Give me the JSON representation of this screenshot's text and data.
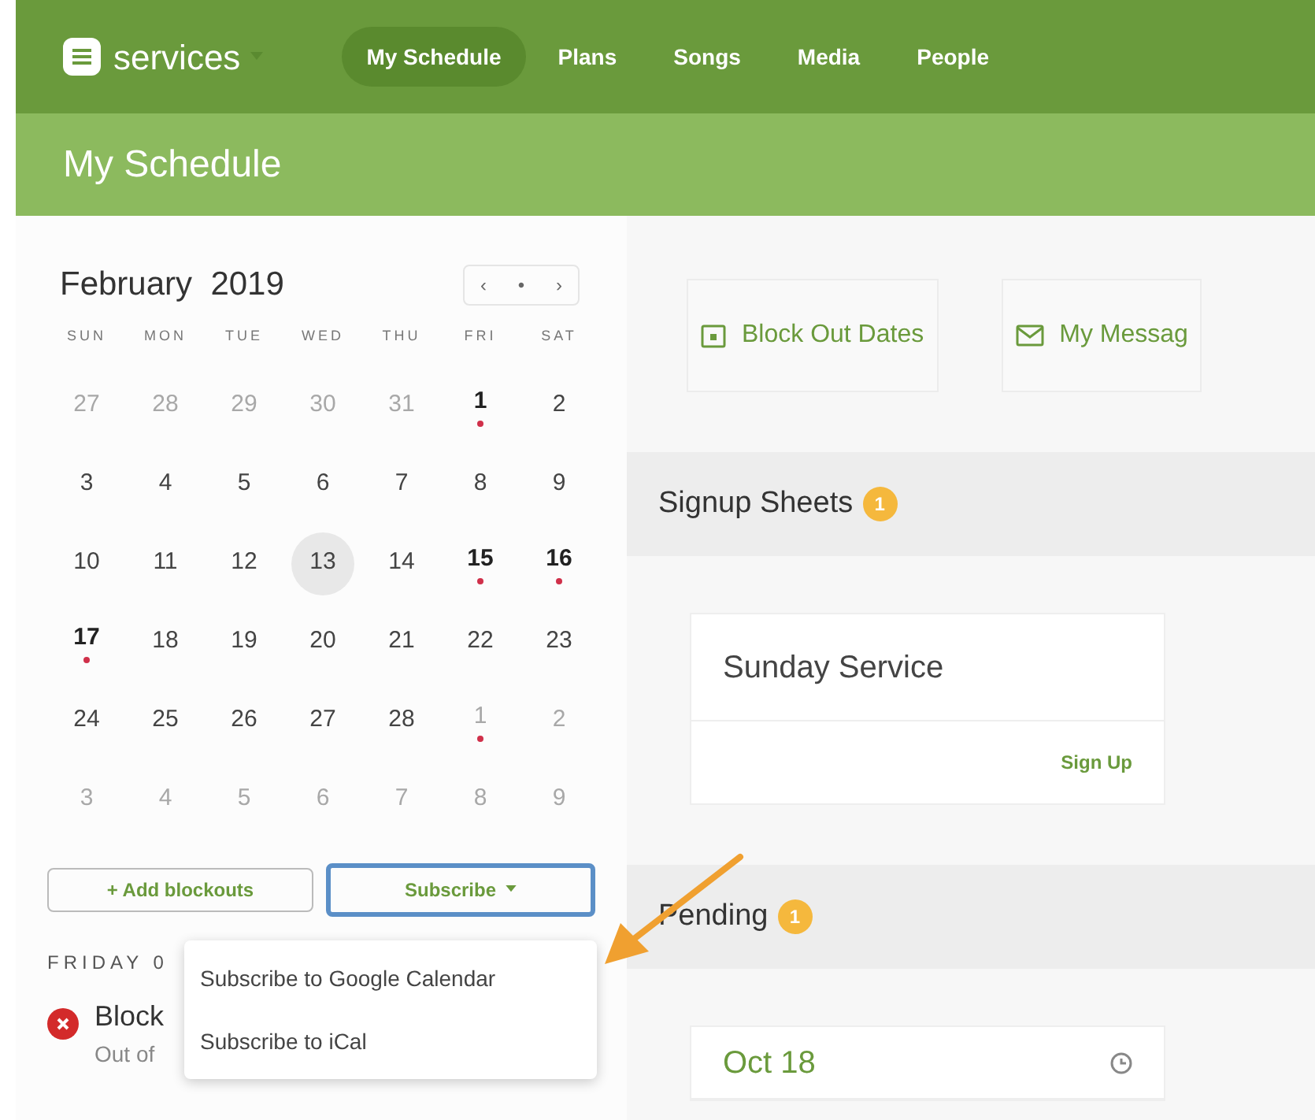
{
  "app": {
    "name": "services"
  },
  "nav": [
    {
      "label": "My Schedule",
      "selected": true
    },
    {
      "label": "Plans",
      "selected": false
    },
    {
      "label": "Songs",
      "selected": false
    },
    {
      "label": "Media",
      "selected": false
    },
    {
      "label": "People",
      "selected": false
    }
  ],
  "page_title": "My Schedule",
  "calendar": {
    "month": "February",
    "year": "2019",
    "controls": [
      "‹",
      "•",
      "›"
    ],
    "weekdays": [
      "SUN",
      "MON",
      "TUE",
      "WED",
      "THU",
      "FRI",
      "SAT"
    ],
    "weeks": [
      [
        {
          "label": "27",
          "muted": true,
          "event": false,
          "selected": false
        },
        {
          "label": "28",
          "muted": true,
          "event": false,
          "selected": false
        },
        {
          "label": "29",
          "muted": true,
          "event": false,
          "selected": false
        },
        {
          "label": "30",
          "muted": true,
          "event": false,
          "selected": false
        },
        {
          "label": "31",
          "muted": true,
          "event": false,
          "selected": false
        },
        {
          "label": "1",
          "muted": false,
          "event": true,
          "selected": false
        },
        {
          "label": "2",
          "muted": false,
          "event": false,
          "selected": false
        }
      ],
      [
        {
          "label": "3",
          "muted": false,
          "event": false,
          "selected": false
        },
        {
          "label": "4",
          "muted": false,
          "event": false,
          "selected": false
        },
        {
          "label": "5",
          "muted": false,
          "event": false,
          "selected": false
        },
        {
          "label": "6",
          "muted": false,
          "event": false,
          "selected": false
        },
        {
          "label": "7",
          "muted": false,
          "event": false,
          "selected": false
        },
        {
          "label": "8",
          "muted": false,
          "event": false,
          "selected": false
        },
        {
          "label": "9",
          "muted": false,
          "event": false,
          "selected": false
        }
      ],
      [
        {
          "label": "10",
          "muted": false,
          "event": false,
          "selected": false
        },
        {
          "label": "11",
          "muted": false,
          "event": false,
          "selected": false
        },
        {
          "label": "12",
          "muted": false,
          "event": false,
          "selected": false
        },
        {
          "label": "13",
          "muted": false,
          "event": false,
          "selected": true
        },
        {
          "label": "14",
          "muted": false,
          "event": false,
          "selected": false
        },
        {
          "label": "15",
          "muted": false,
          "event": true,
          "selected": false
        },
        {
          "label": "16",
          "muted": false,
          "event": true,
          "selected": false
        }
      ],
      [
        {
          "label": "17",
          "muted": false,
          "event": true,
          "selected": false
        },
        {
          "label": "18",
          "muted": false,
          "event": false,
          "selected": false
        },
        {
          "label": "19",
          "muted": false,
          "event": false,
          "selected": false
        },
        {
          "label": "20",
          "muted": false,
          "event": false,
          "selected": false
        },
        {
          "label": "21",
          "muted": false,
          "event": false,
          "selected": false
        },
        {
          "label": "22",
          "muted": false,
          "event": false,
          "selected": false
        },
        {
          "label": "23",
          "muted": false,
          "event": false,
          "selected": false
        }
      ],
      [
        {
          "label": "24",
          "muted": false,
          "event": false,
          "selected": false
        },
        {
          "label": "25",
          "muted": false,
          "event": false,
          "selected": false
        },
        {
          "label": "26",
          "muted": false,
          "event": false,
          "selected": false
        },
        {
          "label": "27",
          "muted": false,
          "event": false,
          "selected": false
        },
        {
          "label": "28",
          "muted": false,
          "event": false,
          "selected": false
        },
        {
          "label": "1",
          "muted": true,
          "event": true,
          "selected": false
        },
        {
          "label": "2",
          "muted": true,
          "event": false,
          "selected": false
        }
      ],
      [
        {
          "label": "3",
          "muted": true,
          "event": false,
          "selected": false
        },
        {
          "label": "4",
          "muted": true,
          "event": false,
          "selected": false
        },
        {
          "label": "5",
          "muted": true,
          "event": false,
          "selected": false
        },
        {
          "label": "6",
          "muted": true,
          "event": false,
          "selected": false
        },
        {
          "label": "7",
          "muted": true,
          "event": false,
          "selected": false
        },
        {
          "label": "8",
          "muted": true,
          "event": false,
          "selected": false
        },
        {
          "label": "9",
          "muted": true,
          "event": false,
          "selected": false
        }
      ]
    ]
  },
  "buttons": {
    "add": "+ Add blockouts",
    "subscribe": "Subscribe"
  },
  "subscribe_menu": {
    "expanded": true,
    "items": [
      "Subscribe to Google Calendar",
      "Subscribe to iCal"
    ]
  },
  "day_heading": "FRIDAY 0",
  "blockout": {
    "title": "Block",
    "subtitle": "Out of"
  },
  "actions": [
    "Block Out Dates",
    "My Messag"
  ],
  "sections": [
    {
      "title": "Signup Sheets",
      "count": "1",
      "cards": [
        {
          "title": "Sunday Service",
          "action": "Sign Up"
        }
      ]
    },
    {
      "title": "Pending",
      "count": "1",
      "cards": [
        {
          "title": "Oct 18"
        }
      ]
    }
  ]
}
